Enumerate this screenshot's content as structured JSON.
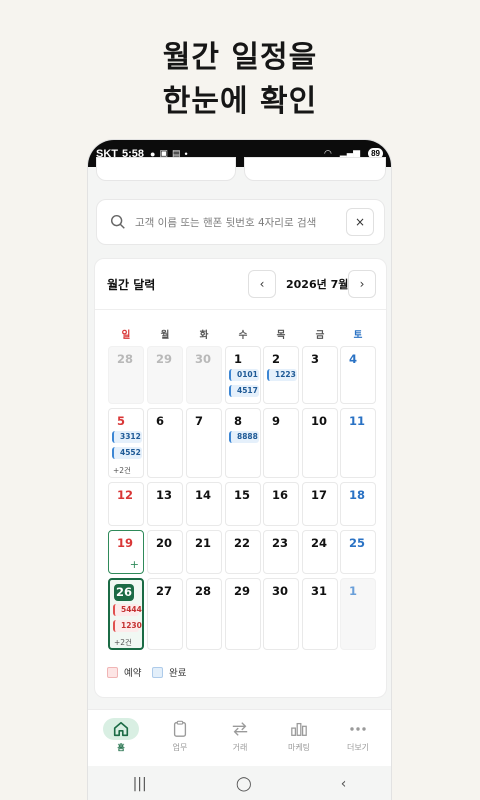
{
  "promo": {
    "line1": "월간 일정을",
    "line2": "한눈에 확인"
  },
  "status_bar": {
    "carrier": "SKT",
    "time": "5:58",
    "battery": "89"
  },
  "search": {
    "placeholder": "고객 이름 또는 핸폰 뒷번호 4자리로 검색",
    "clear_label": "×"
  },
  "calendar": {
    "title": "월간 달력",
    "month_label": "2026년 7월",
    "prev_label": "‹",
    "next_label": "›",
    "weekdays": [
      "일",
      "월",
      "화",
      "수",
      "목",
      "금",
      "토"
    ],
    "weeks": [
      [
        {
          "day": "28",
          "muted": true
        },
        {
          "day": "29",
          "muted": true
        },
        {
          "day": "30",
          "muted": true
        },
        {
          "day": "1",
          "chips": [
            "0101",
            "4517"
          ]
        },
        {
          "day": "2",
          "chips": [
            "1223"
          ]
        },
        {
          "day": "3"
        },
        {
          "day": "4"
        }
      ],
      [
        {
          "day": "5",
          "chips": [
            "3312",
            "4552"
          ],
          "more": "+2건"
        },
        {
          "day": "6"
        },
        {
          "day": "7"
        },
        {
          "day": "8",
          "chips": [
            "8888"
          ]
        },
        {
          "day": "9"
        },
        {
          "day": "10"
        },
        {
          "day": "11"
        }
      ],
      [
        {
          "day": "12"
        },
        {
          "day": "13"
        },
        {
          "day": "14"
        },
        {
          "day": "15"
        },
        {
          "day": "16"
        },
        {
          "day": "17"
        },
        {
          "day": "18"
        }
      ],
      [
        {
          "day": "19",
          "selected": true,
          "add_label": "+"
        },
        {
          "day": "20"
        },
        {
          "day": "21"
        },
        {
          "day": "22"
        },
        {
          "day": "23"
        },
        {
          "day": "24"
        },
        {
          "day": "25"
        }
      ],
      [
        {
          "day": "26",
          "today": true,
          "chips": [
            "5444",
            "1230"
          ],
          "chip_style": "red",
          "more": "+2건"
        },
        {
          "day": "27"
        },
        {
          "day": "28"
        },
        {
          "day": "29"
        },
        {
          "day": "30"
        },
        {
          "day": "31"
        },
        {
          "day": "1",
          "muted": true
        }
      ]
    ],
    "legend": [
      {
        "label": "예약",
        "color": "#fde5e5",
        "border": "#f0b5b5"
      },
      {
        "label": "완료",
        "color": "#e3effa",
        "border": "#aecbea"
      }
    ]
  },
  "bottom_nav": [
    {
      "label": "홈",
      "icon": "home-icon",
      "active": true
    },
    {
      "label": "업무",
      "icon": "clipboard-icon"
    },
    {
      "label": "거래",
      "icon": "swap-icon"
    },
    {
      "label": "마케팅",
      "icon": "bar-chart-icon"
    },
    {
      "label": "더보기",
      "icon": "more-icon"
    }
  ],
  "colors": {
    "brand": "#1b6b45",
    "sunday": "#d93636",
    "saturday": "#2a72c4"
  }
}
